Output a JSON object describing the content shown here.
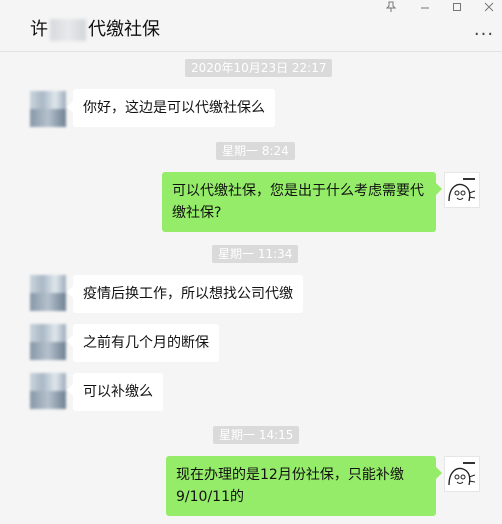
{
  "header": {
    "title_prefix": "许",
    "title_suffix": "代缴社保",
    "more_label": "...",
    "controls": {
      "pin": "pin-icon",
      "minimize": "minimize-icon",
      "maximize": "maximize-icon",
      "close": "close-icon"
    }
  },
  "timestamps": [
    "2020年10月23日 22:17",
    "星期一 8:24",
    "星期一 11:34",
    "星期一 14:15"
  ],
  "messages": [
    {
      "side": "left",
      "text": "你好，这边是可以代缴社保么"
    },
    {
      "side": "right",
      "text": "可以代缴社保，您是出于什么考虑需要代缴社保?"
    },
    {
      "side": "left",
      "text": "疫情后换工作，所以想找公司代缴"
    },
    {
      "side": "left",
      "text": "之前有几个月的断保"
    },
    {
      "side": "left",
      "text": "可以补缴么"
    },
    {
      "side": "right",
      "text": "现在办理的是12月份社保，只能补缴9/10/11的"
    }
  ],
  "colors": {
    "background": "#f5f5f5",
    "bubble_right": "#95ec69",
    "bubble_left": "#ffffff",
    "time_badge": "#dadada"
  }
}
